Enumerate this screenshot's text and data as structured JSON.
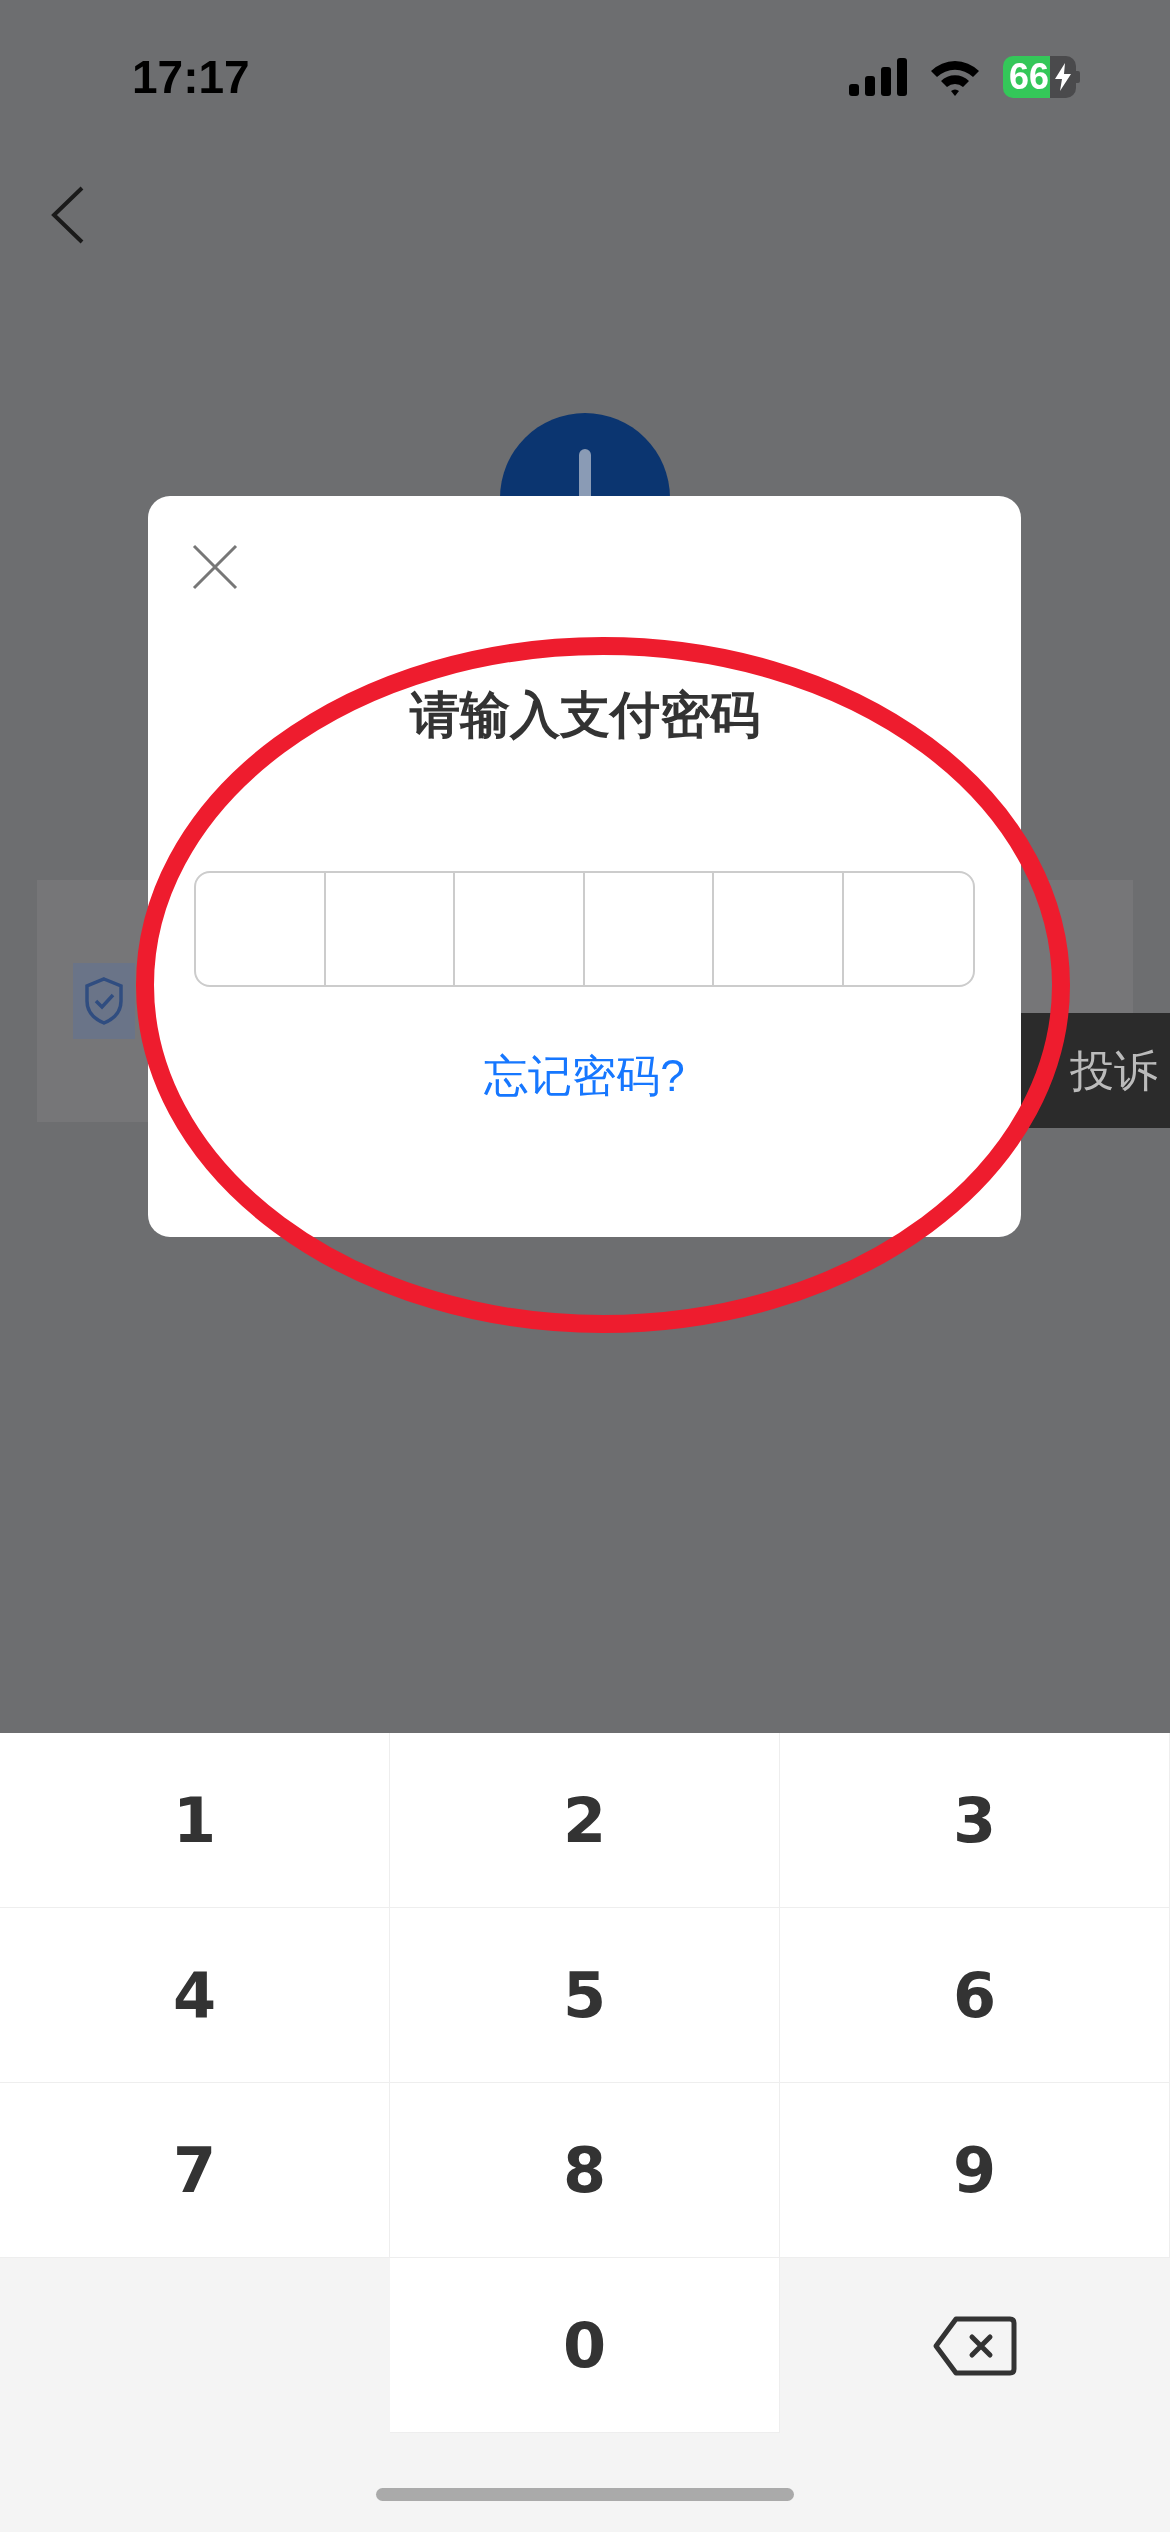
{
  "status_bar": {
    "time": "17:17",
    "battery": "66"
  },
  "background": {
    "toast": "投诉"
  },
  "dialog": {
    "title": "请输入支付密码",
    "link": "忘记密码?"
  },
  "keypad": {
    "keys": [
      {
        "kind": "digit",
        "label": "1"
      },
      {
        "kind": "digit",
        "label": "2"
      },
      {
        "kind": "digit",
        "label": "3"
      },
      {
        "kind": "digit",
        "label": "4"
      },
      {
        "kind": "digit",
        "label": "5"
      },
      {
        "kind": "digit",
        "label": "6"
      },
      {
        "kind": "digit",
        "label": "7"
      },
      {
        "kind": "digit",
        "label": "8"
      },
      {
        "kind": "digit",
        "label": "9"
      },
      {
        "kind": "blank"
      },
      {
        "kind": "digit",
        "label": "0"
      },
      {
        "kind": "delete"
      }
    ]
  }
}
